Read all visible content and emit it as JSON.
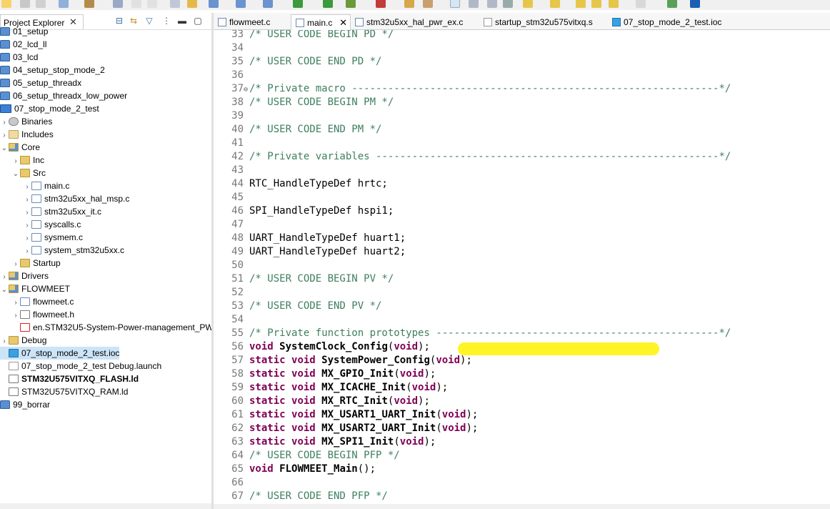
{
  "project_explorer": {
    "title": "Project Explorer",
    "close": "✕",
    "tree": [
      {
        "label": "01_setup",
        "icon": "project-folder-icon",
        "kind": "proj",
        "level": 0
      },
      {
        "label": "02_lcd_ll",
        "icon": "project-folder-icon",
        "kind": "proj",
        "level": 0
      },
      {
        "label": "03_lcd",
        "icon": "project-folder-icon",
        "kind": "proj",
        "level": 0
      },
      {
        "label": "04_setup_stop_mode_2",
        "icon": "project-folder-icon",
        "kind": "proj",
        "level": 0
      },
      {
        "label": "05_setup_threadx",
        "icon": "project-folder-icon",
        "kind": "proj",
        "level": 0
      },
      {
        "label": "06_setup_threadx_low_power",
        "icon": "project-folder-icon",
        "kind": "proj",
        "level": 0
      },
      {
        "label": "07_stop_mode_2_test",
        "icon": "ide-project-icon",
        "kind": "ide",
        "level": 0
      },
      {
        "label": "Binaries",
        "icon": "binaries-icon",
        "kind": "bin",
        "level": 1,
        "arrow": "›"
      },
      {
        "label": "Includes",
        "icon": "includes-icon",
        "kind": "inc",
        "level": 1,
        "arrow": "›"
      },
      {
        "label": "Core",
        "icon": "source-folder-icon",
        "kind": "srcfolder",
        "level": 1,
        "arrow": "⌄"
      },
      {
        "label": "Inc",
        "icon": "folder-icon",
        "kind": "folder",
        "level": 2,
        "arrow": "›"
      },
      {
        "label": "Src",
        "icon": "folder-icon",
        "kind": "folder",
        "level": 2,
        "arrow": "⌄"
      },
      {
        "label": "main.c",
        "icon": "c-file-icon",
        "kind": "c",
        "level": 3,
        "arrow": "›"
      },
      {
        "label": "stm32u5xx_hal_msp.c",
        "icon": "c-file-icon",
        "kind": "c",
        "level": 3,
        "arrow": "›"
      },
      {
        "label": "stm32u5xx_it.c",
        "icon": "c-file-icon",
        "kind": "c",
        "level": 3,
        "arrow": "›"
      },
      {
        "label": "syscalls.c",
        "icon": "c-file-icon",
        "kind": "c",
        "level": 3,
        "arrow": "›"
      },
      {
        "label": "sysmem.c",
        "icon": "c-file-icon",
        "kind": "c",
        "level": 3,
        "arrow": "›"
      },
      {
        "label": "system_stm32u5xx.c",
        "icon": "c-file-icon",
        "kind": "c",
        "level": 3,
        "arrow": "›"
      },
      {
        "label": "Startup",
        "icon": "folder-icon",
        "kind": "folder",
        "level": 2,
        "arrow": "›"
      },
      {
        "label": "Drivers",
        "icon": "source-folder-icon",
        "kind": "srcfolder",
        "level": 1,
        "arrow": "›"
      },
      {
        "label": "FLOWMEET",
        "icon": "source-folder-icon",
        "kind": "srcfolder",
        "level": 1,
        "arrow": "⌄"
      },
      {
        "label": "flowmeet.c",
        "icon": "c-file-icon",
        "kind": "c",
        "level": 2,
        "arrow": "›"
      },
      {
        "label": "flowmeet.h",
        "icon": "h-file-icon",
        "kind": "h",
        "level": 2,
        "arrow": "›"
      },
      {
        "label": "en.STM32U5-System-Power-management_PW",
        "icon": "pdf-file-icon",
        "kind": "pdf",
        "level": 2
      },
      {
        "label": "Debug",
        "icon": "folder-icon",
        "kind": "folder",
        "level": 1,
        "arrow": "›"
      },
      {
        "label": "07_stop_mode_2_test.ioc",
        "icon": "mx-file-icon",
        "kind": "mx",
        "level": 1,
        "selected": true
      },
      {
        "label": "07_stop_mode_2_test Debug.launch",
        "icon": "launch-file-icon",
        "kind": "launch",
        "level": 1
      },
      {
        "label": "STM32U575VITXQ_FLASH.ld",
        "icon": "ld-file-icon",
        "kind": "ld",
        "level": 1,
        "bold": true
      },
      {
        "label": "STM32U575VITXQ_RAM.ld",
        "icon": "ld-file-icon",
        "kind": "ld",
        "level": 1
      },
      {
        "label": "99_borrar",
        "icon": "project-folder-icon",
        "kind": "proj",
        "level": 0
      }
    ]
  },
  "editor_tabs": [
    {
      "label": "flowmeet.c",
      "icon": "c-file-icon",
      "active": false
    },
    {
      "label": "main.c",
      "icon": "c-file-icon",
      "active": true,
      "close": "✕"
    },
    {
      "label": "stm32u5xx_hal_pwr_ex.c",
      "icon": "c-file-icon",
      "active": false
    },
    {
      "label": "startup_stm32u575vitxq.s",
      "icon": "s-file-icon",
      "active": false
    },
    {
      "label": "07_stop_mode_2_test.ioc",
      "icon": "mx-file-icon",
      "active": false
    }
  ],
  "code_lines": [
    {
      "n": "33",
      "parts": [
        {
          "t": "/* USER CODE BEGIN PD */",
          "c": "cmt"
        }
      ]
    },
    {
      "n": "34",
      "parts": []
    },
    {
      "n": "35",
      "parts": [
        {
          "t": "/* USER CODE END PD */",
          "c": "cmt"
        }
      ]
    },
    {
      "n": "36",
      "parts": []
    },
    {
      "n": "37",
      "fold": "⊖",
      "parts": [
        {
          "t": "/* Private macro -------------------------------------------------------------*/",
          "c": "cmt"
        }
      ]
    },
    {
      "n": "38",
      "parts": [
        {
          "t": "/* USER CODE BEGIN PM */",
          "c": "cmt"
        }
      ]
    },
    {
      "n": "39",
      "parts": []
    },
    {
      "n": "40",
      "parts": [
        {
          "t": "/* USER CODE END PM */",
          "c": "cmt"
        }
      ]
    },
    {
      "n": "41",
      "parts": []
    },
    {
      "n": "42",
      "parts": [
        {
          "t": "/* Private variables ---------------------------------------------------------*/",
          "c": "cmt"
        }
      ]
    },
    {
      "n": "43",
      "parts": []
    },
    {
      "n": "44",
      "parts": [
        {
          "t": "RTC_HandleTypeDef hrtc;",
          "c": "tx"
        }
      ]
    },
    {
      "n": "45",
      "parts": []
    },
    {
      "n": "46",
      "parts": [
        {
          "t": "SPI_HandleTypeDef hspi1;",
          "c": "tx"
        }
      ]
    },
    {
      "n": "47",
      "parts": []
    },
    {
      "n": "48",
      "parts": [
        {
          "t": "UART_HandleTypeDef huart1;",
          "c": "tx"
        }
      ]
    },
    {
      "n": "49",
      "parts": [
        {
          "t": "UART_HandleTypeDef huart2;",
          "c": "tx"
        }
      ]
    },
    {
      "n": "50",
      "parts": []
    },
    {
      "n": "51",
      "parts": [
        {
          "t": "/* USER CODE BEGIN PV */",
          "c": "cmt"
        }
      ]
    },
    {
      "n": "52",
      "parts": []
    },
    {
      "n": "53",
      "parts": [
        {
          "t": "/* USER CODE END PV */",
          "c": "cmt"
        }
      ]
    },
    {
      "n": "54",
      "parts": []
    },
    {
      "n": "55",
      "parts": [
        {
          "t": "/* Private function prototypes -----------------------------------------------*/",
          "c": "cmt"
        }
      ]
    },
    {
      "n": "56",
      "parts": [
        {
          "t": "void",
          "c": "kw"
        },
        {
          "t": " ",
          "c": "tx"
        },
        {
          "t": "SystemClock_Config",
          "c": "fn"
        },
        {
          "t": "(",
          "c": "tx"
        },
        {
          "t": "void",
          "c": "kw"
        },
        {
          "t": ");",
          "c": "tx"
        }
      ]
    },
    {
      "n": "57",
      "parts": [
        {
          "t": "static",
          "c": "kw"
        },
        {
          "t": " ",
          "c": "tx"
        },
        {
          "t": "void",
          "c": "kw"
        },
        {
          "t": " ",
          "c": "tx"
        },
        {
          "t": "SystemPower_Config",
          "c": "fn"
        },
        {
          "t": "(",
          "c": "tx"
        },
        {
          "t": "void",
          "c": "kw"
        },
        {
          "t": ");",
          "c": "tx"
        }
      ]
    },
    {
      "n": "58",
      "parts": [
        {
          "t": "static",
          "c": "kw"
        },
        {
          "t": " ",
          "c": "tx"
        },
        {
          "t": "void",
          "c": "kw"
        },
        {
          "t": " ",
          "c": "tx"
        },
        {
          "t": "MX_GPIO_Init",
          "c": "fn"
        },
        {
          "t": "(",
          "c": "tx"
        },
        {
          "t": "void",
          "c": "kw"
        },
        {
          "t": ");",
          "c": "tx"
        }
      ]
    },
    {
      "n": "59",
      "parts": [
        {
          "t": "static",
          "c": "kw"
        },
        {
          "t": " ",
          "c": "tx"
        },
        {
          "t": "void",
          "c": "kw"
        },
        {
          "t": " ",
          "c": "tx"
        },
        {
          "t": "MX_ICACHE_Init",
          "c": "fn"
        },
        {
          "t": "(",
          "c": "tx"
        },
        {
          "t": "void",
          "c": "kw"
        },
        {
          "t": ");",
          "c": "tx"
        }
      ]
    },
    {
      "n": "60",
      "parts": [
        {
          "t": "static",
          "c": "kw"
        },
        {
          "t": " ",
          "c": "tx"
        },
        {
          "t": "void",
          "c": "kw"
        },
        {
          "t": " ",
          "c": "tx"
        },
        {
          "t": "MX_RTC_Init",
          "c": "fn"
        },
        {
          "t": "(",
          "c": "tx"
        },
        {
          "t": "void",
          "c": "kw"
        },
        {
          "t": ");",
          "c": "tx"
        }
      ]
    },
    {
      "n": "61",
      "parts": [
        {
          "t": "static",
          "c": "kw"
        },
        {
          "t": " ",
          "c": "tx"
        },
        {
          "t": "void",
          "c": "kw"
        },
        {
          "t": " ",
          "c": "tx"
        },
        {
          "t": "MX_USART1_UART_Init",
          "c": "fn"
        },
        {
          "t": "(",
          "c": "tx"
        },
        {
          "t": "void",
          "c": "kw"
        },
        {
          "t": ");",
          "c": "tx"
        }
      ]
    },
    {
      "n": "62",
      "parts": [
        {
          "t": "static",
          "c": "kw"
        },
        {
          "t": " ",
          "c": "tx"
        },
        {
          "t": "void",
          "c": "kw"
        },
        {
          "t": " ",
          "c": "tx"
        },
        {
          "t": "MX_USART2_UART_Init",
          "c": "fn"
        },
        {
          "t": "(",
          "c": "tx"
        },
        {
          "t": "void",
          "c": "kw"
        },
        {
          "t": ");",
          "c": "tx"
        }
      ]
    },
    {
      "n": "63",
      "parts": [
        {
          "t": "static",
          "c": "kw"
        },
        {
          "t": " ",
          "c": "tx"
        },
        {
          "t": "void",
          "c": "kw"
        },
        {
          "t": " ",
          "c": "tx"
        },
        {
          "t": "MX_SPI1_Init",
          "c": "fn"
        },
        {
          "t": "(",
          "c": "tx"
        },
        {
          "t": "void",
          "c": "kw"
        },
        {
          "t": ");",
          "c": "tx"
        }
      ]
    },
    {
      "n": "64",
      "parts": [
        {
          "t": "/* USER CODE BEGIN PFP */",
          "c": "cmt"
        }
      ]
    },
    {
      "n": "65",
      "parts": [
        {
          "t": "void",
          "c": "kw"
        },
        {
          "t": " ",
          "c": "tx"
        },
        {
          "t": "FLOWMEET_Main",
          "c": "fn"
        },
        {
          "t": "();",
          "c": "tx"
        }
      ]
    },
    {
      "n": "66",
      "parts": []
    },
    {
      "n": "67",
      "parts": [
        {
          "t": "/* USER CODE END PFP */",
          "c": "cmt"
        }
      ]
    }
  ],
  "colors": {
    "highlight": "#fff200",
    "comment": "#3f7f5f",
    "keyword": "#7f0055",
    "selection": "#cce4f7"
  }
}
